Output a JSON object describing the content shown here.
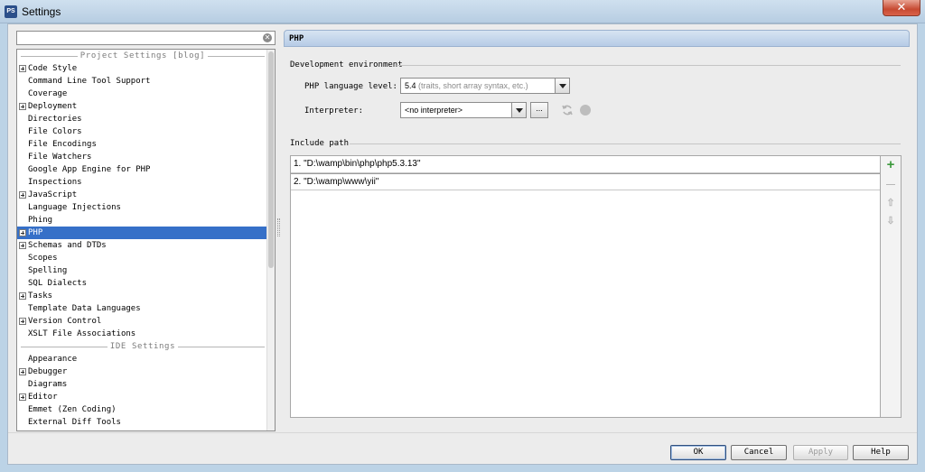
{
  "window": {
    "icon_text": "PS",
    "title": "Settings",
    "close_glyph": "✕"
  },
  "search": {
    "value": "",
    "clear_glyph": "✕"
  },
  "tree": {
    "project_header": "Project Settings [blog]",
    "project_items": [
      {
        "label": "Code Style",
        "expandable": true
      },
      {
        "label": "Command Line Tool Support",
        "expandable": false
      },
      {
        "label": "Coverage",
        "expandable": false
      },
      {
        "label": "Deployment",
        "expandable": true
      },
      {
        "label": "Directories",
        "expandable": false
      },
      {
        "label": "File Colors",
        "expandable": false
      },
      {
        "label": "File Encodings",
        "expandable": false
      },
      {
        "label": "File Watchers",
        "expandable": false
      },
      {
        "label": "Google App Engine for PHP",
        "expandable": false
      },
      {
        "label": "Inspections",
        "expandable": false
      },
      {
        "label": "JavaScript",
        "expandable": true
      },
      {
        "label": "Language Injections",
        "expandable": false
      },
      {
        "label": "Phing",
        "expandable": false
      },
      {
        "label": "PHP",
        "expandable": true,
        "selected": true
      },
      {
        "label": "Schemas and DTDs",
        "expandable": true
      },
      {
        "label": "Scopes",
        "expandable": false
      },
      {
        "label": "Spelling",
        "expandable": false
      },
      {
        "label": "SQL Dialects",
        "expandable": false
      },
      {
        "label": "Tasks",
        "expandable": true
      },
      {
        "label": "Template Data Languages",
        "expandable": false
      },
      {
        "label": "Version Control",
        "expandable": true
      },
      {
        "label": "XSLT File Associations",
        "expandable": false
      }
    ],
    "ide_header": "IDE Settings",
    "ide_items": [
      {
        "label": "Appearance",
        "expandable": false
      },
      {
        "label": "Debugger",
        "expandable": true
      },
      {
        "label": "Diagrams",
        "expandable": false
      },
      {
        "label": "Editor",
        "expandable": true
      },
      {
        "label": "Emmet (Zen Coding)",
        "expandable": false
      },
      {
        "label": "External Diff Tools",
        "expandable": false
      }
    ]
  },
  "panel": {
    "title": "PHP",
    "dev_env_title": "Development environment",
    "language_level_label": "PHP language level:",
    "language_level_value": "5.4",
    "language_level_hint": "(traits, short array syntax, etc.)",
    "interpreter_label": "Interpreter:",
    "interpreter_value": "<no interpreter>",
    "browse_label": "...",
    "include_path_title": "Include path",
    "include_paths": [
      "1. \"D:\\wamp\\bin\\php\\php5.3.13\"",
      "2. \"D:\\wamp\\www\\yii\""
    ],
    "tool_glyphs": {
      "add": "+",
      "remove": "—",
      "up": "⇧",
      "down": "⇩"
    }
  },
  "buttons": {
    "ok": "OK",
    "cancel": "Cancel",
    "apply": "Apply",
    "help": "Help"
  },
  "colors": {
    "selection": "#3670c8",
    "add_icon": "#3c9a3c",
    "header_bg": "#c3d6ec"
  }
}
